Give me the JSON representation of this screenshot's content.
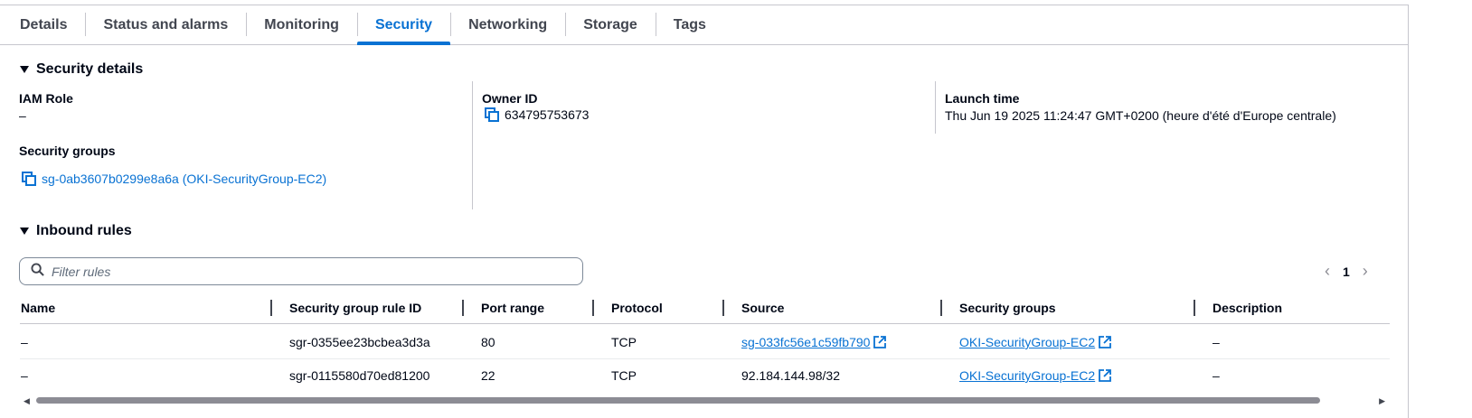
{
  "tabs": [
    {
      "label": "Details"
    },
    {
      "label": "Status and alarms"
    },
    {
      "label": "Monitoring"
    },
    {
      "label": "Security"
    },
    {
      "label": "Networking"
    },
    {
      "label": "Storage"
    },
    {
      "label": "Tags"
    }
  ],
  "active_tab": "Security",
  "security_details": {
    "title": "Security details",
    "iam_role_label": "IAM Role",
    "iam_role_value": "–",
    "owner_id_label": "Owner ID",
    "owner_id_value": "634795753673",
    "launch_time_label": "Launch time",
    "launch_time_value": "Thu Jun 19 2025 11:24:47 GMT+0200 (heure d'été d'Europe centrale)",
    "security_groups_label": "Security groups",
    "security_groups_value": "sg-0ab3607b0299e8a6a (OKI-SecurityGroup-EC2)"
  },
  "inbound_rules": {
    "title": "Inbound rules",
    "filter_placeholder": "Filter rules",
    "current_page": "1",
    "columns": [
      "Name",
      "Security group rule ID",
      "Port range",
      "Protocol",
      "Source",
      "Security groups",
      "Description"
    ],
    "rows": [
      {
        "name": "–",
        "rule_id": "sgr-0355ee23bcbea3d3a",
        "port": "80",
        "protocol": "TCP",
        "source": "sg-033fc56e1c59fb790",
        "security_group": "OKI-SecurityGroup-EC2",
        "description": "–"
      },
      {
        "name": "–",
        "rule_id": "sgr-0115580d70ed81200",
        "port": "22",
        "protocol": "TCP",
        "source": "92.184.144.98/32",
        "security_group": "OKI-SecurityGroup-EC2",
        "description": "–"
      }
    ]
  },
  "colors": {
    "accent": "#0972d3",
    "text": "#000716",
    "muted": "#424650"
  }
}
